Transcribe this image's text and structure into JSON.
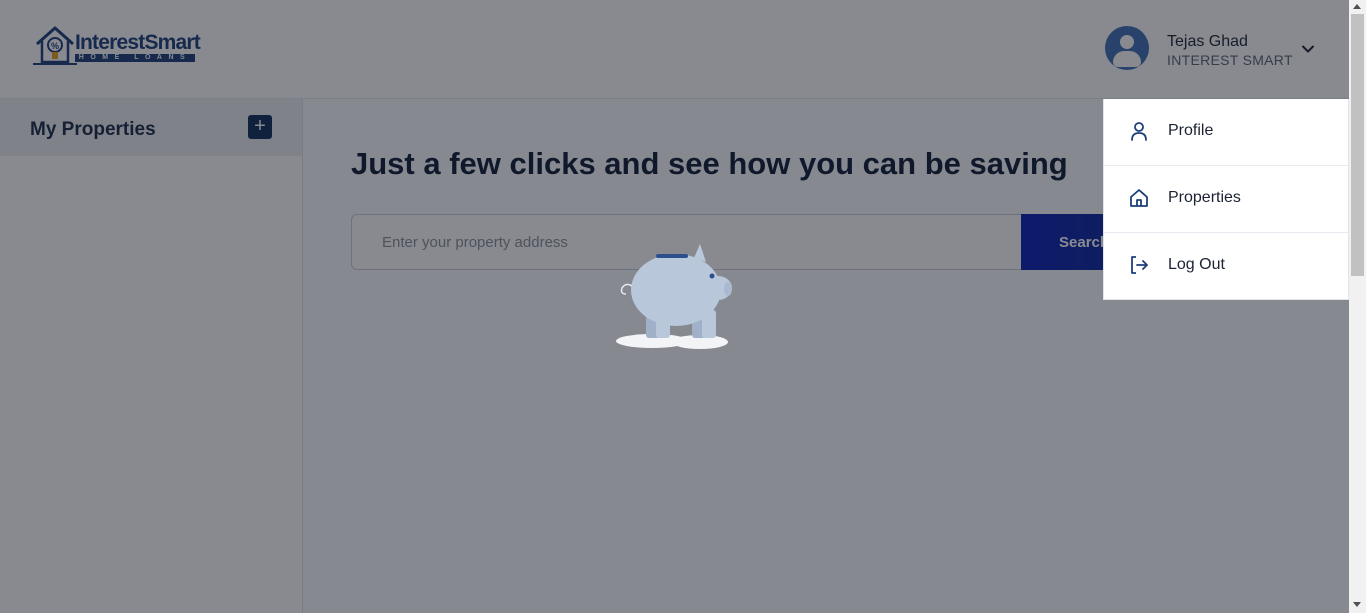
{
  "header": {
    "logo": {
      "brand": "InterestSmart",
      "tagline": "HOME LOANS"
    },
    "user": {
      "name": "Tejas Ghad",
      "company": "INTEREST SMART",
      "avatar_icon": "user-avatar-icon",
      "menu_icon": "chevron-down-icon"
    }
  },
  "sidebar": {
    "title": "My Properties",
    "add_label": "+",
    "add_icon": "plus-icon"
  },
  "main": {
    "heading": "Just a few clicks and see how you can be saving",
    "search": {
      "placeholder": "Enter your property address",
      "value": "",
      "button_label": "Search"
    }
  },
  "loading": {
    "icon": "piggy-bank-icon"
  },
  "user_menu": {
    "items": [
      {
        "label": "Profile",
        "icon": "person-icon"
      },
      {
        "label": "Properties",
        "icon": "home-icon"
      },
      {
        "label": "Log Out",
        "icon": "logout-icon"
      }
    ]
  },
  "colors": {
    "brand": "#1d3f7a",
    "accent": "#0b1fb8",
    "sidebar_header_bg": "#eceef2",
    "overlay": "#121620"
  }
}
